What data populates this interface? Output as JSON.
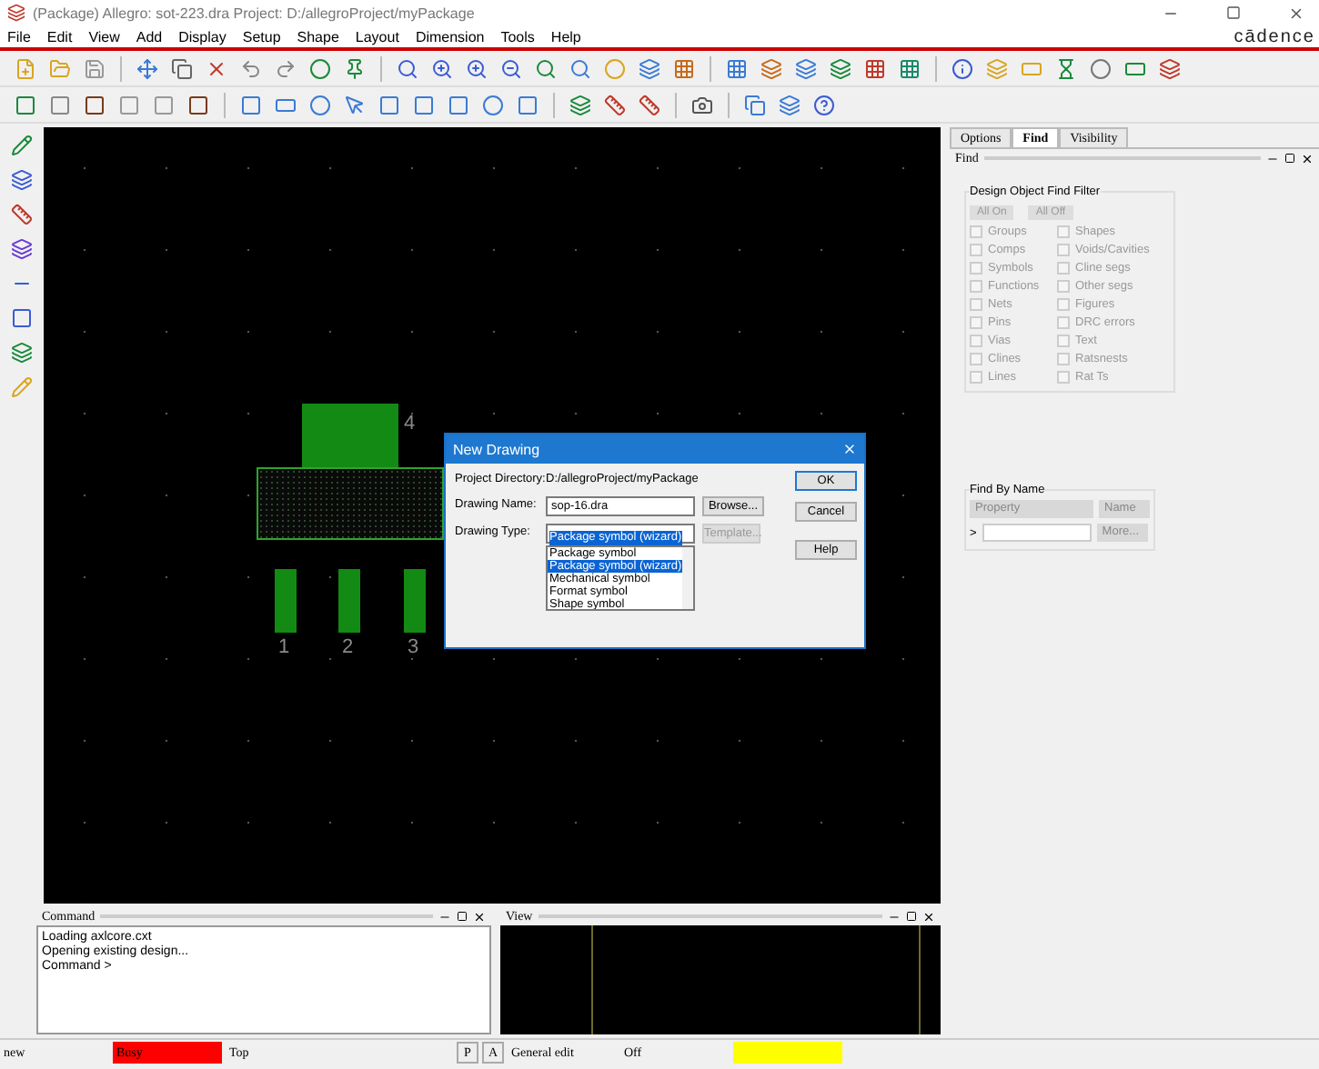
{
  "window": {
    "title": "(Package) Allegro: sot-223.dra  Project: D:/allegroProject/myPackage"
  },
  "menu": [
    "File",
    "Edit",
    "View",
    "Add",
    "Display",
    "Setup",
    "Shape",
    "Layout",
    "Dimension",
    "Tools",
    "Help"
  ],
  "logo": "cādence",
  "canvas": {
    "pins": [
      {
        "label": "4",
        "kind": "top"
      },
      {
        "label": "1",
        "kind": "bottom"
      },
      {
        "label": "2",
        "kind": "bottom"
      },
      {
        "label": "3",
        "kind": "bottom"
      }
    ]
  },
  "dialog": {
    "title": "New Drawing",
    "project_directory_label": "Project Directory:",
    "project_directory": "D:/allegroProject/myPackage",
    "drawing_name_label": "Drawing Name:",
    "drawing_name": "sop-16.dra",
    "drawing_type_label": "Drawing Type:",
    "drawing_type": "Package symbol (wizard)",
    "types": [
      {
        "label": "Package symbol",
        "selected": false
      },
      {
        "label": "Package symbol (wizard)",
        "selected": true
      },
      {
        "label": "Mechanical symbol",
        "selected": false
      },
      {
        "label": "Format symbol",
        "selected": false
      },
      {
        "label": "Shape symbol",
        "selected": false
      }
    ],
    "browse": "Browse...",
    "template": {
      "label": "Template...",
      "disabled": true
    },
    "ok": "OK",
    "cancel": "Cancel",
    "help": "Help"
  },
  "right_panel": {
    "tabs": [
      {
        "label": "Options",
        "selected": false
      },
      {
        "label": "Find",
        "selected": true
      },
      {
        "label": "Visibility",
        "selected": false
      }
    ],
    "header": "Find",
    "filter_title": "Design Object Find Filter",
    "all_on": "All On",
    "all_off": "All Off",
    "items": [
      {
        "label": "Groups",
        "checked": false
      },
      {
        "label": "Shapes",
        "checked": false
      },
      {
        "label": "Comps",
        "checked": false
      },
      {
        "label": "Voids/Cavities",
        "checked": false
      },
      {
        "label": "Symbols",
        "checked": false
      },
      {
        "label": "Cline segs",
        "checked": false
      },
      {
        "label": "Functions",
        "checked": false
      },
      {
        "label": "Other segs",
        "checked": false
      },
      {
        "label": "Nets",
        "checked": false
      },
      {
        "label": "Figures",
        "checked": false
      },
      {
        "label": "Pins",
        "checked": false
      },
      {
        "label": "DRC errors",
        "checked": false
      },
      {
        "label": "Vias",
        "checked": false
      },
      {
        "label": "Text",
        "checked": false
      },
      {
        "label": "Clines",
        "checked": false
      },
      {
        "label": "Ratsnests",
        "checked": false
      },
      {
        "label": "Lines",
        "checked": false
      },
      {
        "label": "Rat Ts",
        "checked": false
      }
    ],
    "find_by_name": {
      "title": "Find By Name",
      "property": "Property",
      "name": "Name",
      "prompt": ">",
      "more": "More..."
    }
  },
  "command": {
    "title": "Command",
    "lines": [
      "Loading axlcore.cxt",
      "Opening existing design...",
      "Command >"
    ]
  },
  "view": {
    "title": "View"
  },
  "status": [
    {
      "text": "new",
      "kind": "field"
    },
    {
      "text": "Busy",
      "color": "#ff0000",
      "kind": "field"
    },
    {
      "text": "Top",
      "kind": "field"
    },
    {
      "text": "P",
      "kind": "button"
    },
    {
      "text": "A",
      "kind": "button"
    },
    {
      "text": "General edit",
      "kind": "field"
    },
    {
      "text": "Off",
      "kind": "field"
    },
    {
      "color": "#ffff00",
      "kind": "field"
    }
  ]
}
